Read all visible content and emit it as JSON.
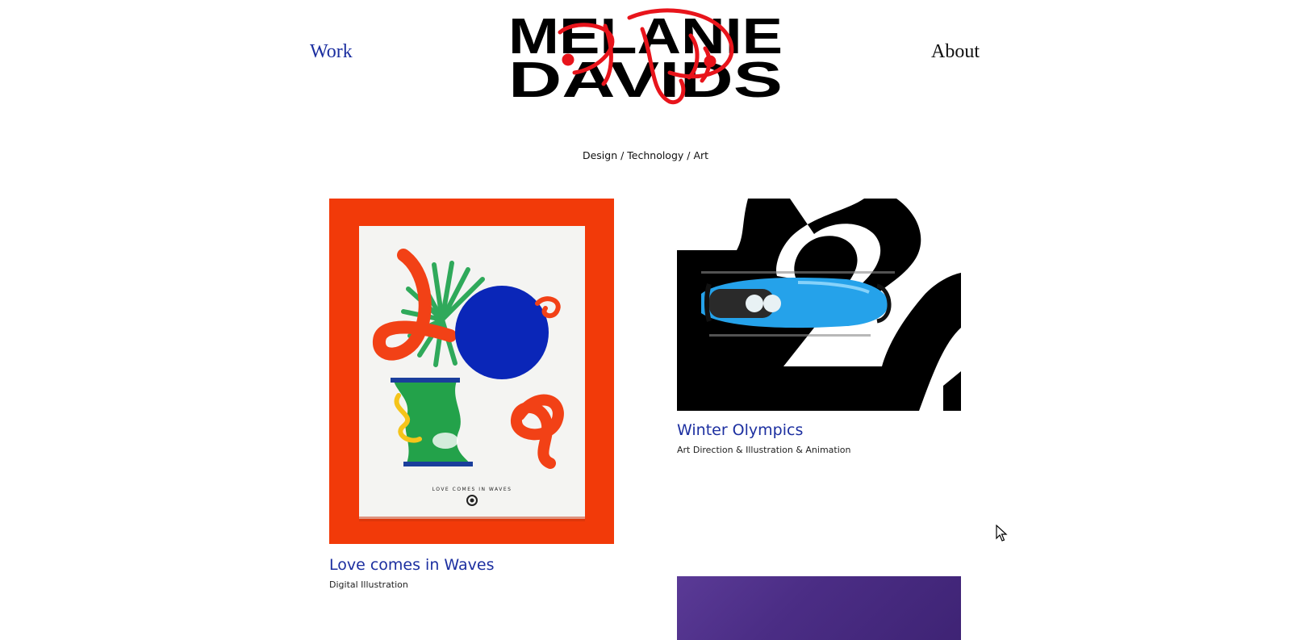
{
  "header": {
    "nav_left": "Work",
    "nav_right": "About",
    "logo_text_line1": "MELANIE",
    "logo_text_line2": "DAVIDS",
    "logo_scribble": "דוידס"
  },
  "tagline": "Design / Technology / Art",
  "projects": [
    {
      "title": "Love comes in Waves",
      "subtitle": "Digital Illustration",
      "poster_caption": "LOVE COMES IN WAVES"
    },
    {
      "title": "Winter Olympics",
      "subtitle": "Art Direction & Illustration & Animation"
    },
    {
      "title": "",
      "subtitle": ""
    }
  ],
  "colors": {
    "accent": "#1c2fa0",
    "love_bg": "#f23a09",
    "purple_bg": "#4b2d85",
    "logo_scribble": "#e8141b"
  },
  "icons": {
    "cursor": "mouse-pointer-icon"
  }
}
